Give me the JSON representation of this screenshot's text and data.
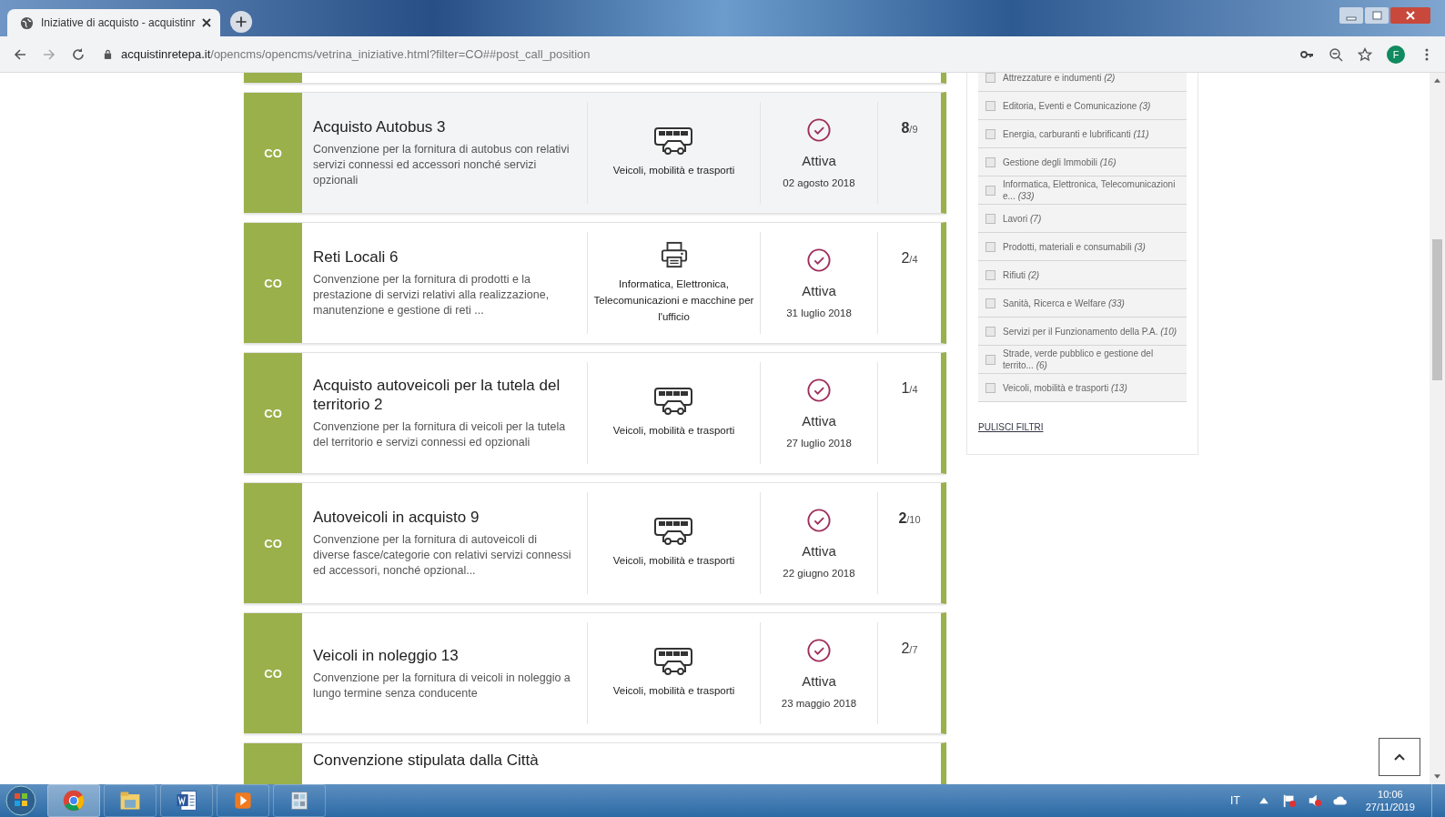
{
  "browser": {
    "tab_title": "Iniziative di acquisto - acquistinr",
    "url_domain": "acquistinretepa.it",
    "url_path": "/opencms/opencms/vetrina_iniziative.html?filter=CO##post_call_position",
    "avatar_letter": "F"
  },
  "cards": [
    {
      "kind": "stub"
    },
    {
      "kind": "full",
      "type_label": "CO",
      "highlighted": true,
      "title": "Acquisto Autobus 3",
      "description": "Convenzione per la fornitura di autobus con relativi servizi connessi ed accessori nonché servizi opzionali",
      "category": "Veicoli, mobilità e trasporti",
      "category_icon": {
        "kind": "vehicles"
      },
      "status": "Attiva",
      "date": "02 agosto 2018",
      "count": "8",
      "total": "/9",
      "count_bold": true
    },
    {
      "kind": "full",
      "type_label": "CO",
      "highlighted": false,
      "title": "Reti Locali 6",
      "description": "Convenzione per la fornitura di prodotti e la prestazione di servizi relativi alla realizzazione, manutenzione e gestione di reti ...",
      "category": "Informatica, Elettronica, Telecomunicazioni e macchine per l'ufficio",
      "category_icon": {
        "kind": "printer"
      },
      "status": "Attiva",
      "date": "31 luglio 2018",
      "count": "2",
      "total": "/4",
      "count_bold": false
    },
    {
      "kind": "full",
      "type_label": "CO",
      "highlighted": false,
      "title": "Acquisto autoveicoli per la tutela del territorio 2",
      "description": "Convenzione per la fornitura di veicoli per la tutela del territorio e servizi connessi ed opzionali",
      "category": "Veicoli, mobilità e trasporti",
      "category_icon": {
        "kind": "vehicles"
      },
      "status": "Attiva",
      "date": "27 luglio 2018",
      "count": "1",
      "total": "/4",
      "count_bold": false
    },
    {
      "kind": "full",
      "type_label": "CO",
      "highlighted": false,
      "title": "Autoveicoli in acquisto 9",
      "description": "Convenzione per la fornitura di autoveicoli di diverse fasce/categorie con relativi servizi connessi ed accessori, nonché opzional...",
      "category": "Veicoli, mobilità e trasporti",
      "category_icon": {
        "kind": "vehicles"
      },
      "status": "Attiva",
      "date": "22 giugno 2018",
      "count": "2",
      "total": "/10",
      "count_bold": true
    },
    {
      "kind": "full",
      "type_label": "CO",
      "highlighted": false,
      "title": "Veicoli in noleggio 13",
      "description": "Convenzione per la fornitura di veicoli in noleggio a lungo termine senza conducente",
      "category": "Veicoli, mobilità e trasporti",
      "category_icon": {
        "kind": "vehicles"
      },
      "status": "Attiva",
      "date": "23 maggio 2018",
      "count": "2",
      "total": "/7",
      "count_bold": false
    },
    {
      "kind": "partial",
      "title": "Convenzione stipulata dalla Città"
    }
  ],
  "filters": {
    "items": [
      {
        "label": "Attrezzature e indumenti",
        "count": "(2)",
        "checked": false
      },
      {
        "label": "Editoria, Eventi e Comunicazione",
        "count": "(3)",
        "checked": false
      },
      {
        "label": "Energia, carburanti e lubrificanti",
        "count": "(11)",
        "checked": false
      },
      {
        "label": "Gestione degli Immobili",
        "count": "(16)",
        "checked": false
      },
      {
        "label": "Informatica, Elettronica, Telecomunicazioni e...",
        "count": "(33)",
        "checked": false
      },
      {
        "label": "Lavori",
        "count": "(7)",
        "checked": false
      },
      {
        "label": "Prodotti, materiali e consumabili",
        "count": "(3)",
        "checked": false
      },
      {
        "label": "Rifiuti",
        "count": "(2)",
        "checked": false
      },
      {
        "label": "Sanità, Ricerca e Welfare",
        "count": "(33)",
        "checked": false
      },
      {
        "label": "Servizi per il Funzionamento della P.A.",
        "count": "(10)",
        "checked": false
      },
      {
        "label": "Strade, verde pubblico e gestione del territo...",
        "count": "(6)",
        "checked": false
      },
      {
        "label": "Veicoli, mobilità e trasporti",
        "count": "(13)",
        "checked": false
      }
    ],
    "clear_label": "PULISCI FILTRI"
  },
  "taskbar": {
    "language": "IT",
    "time": "10:06",
    "date": "27/11/2019"
  }
}
